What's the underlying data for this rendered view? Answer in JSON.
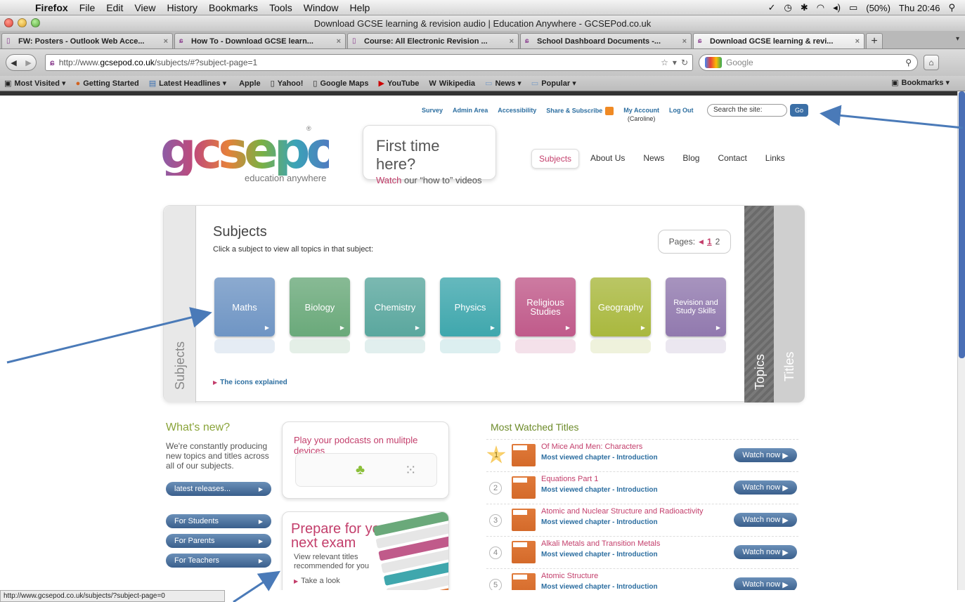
{
  "menubar": {
    "app": "Firefox",
    "items": [
      "File",
      "Edit",
      "View",
      "History",
      "Bookmarks",
      "Tools",
      "Window",
      "Help"
    ],
    "battery": "(50%)",
    "clock": "Thu 20:46"
  },
  "window": {
    "title": "Download GCSE learning & revision audio | Education Anywhere - GCSEPod.co.uk"
  },
  "tabs": [
    {
      "label": "FW: Posters - Outlook Web Acce..."
    },
    {
      "label": "How To - Download GCSE learn..."
    },
    {
      "label": "Course: All Electronic Revision ..."
    },
    {
      "label": "School Dashboard Documents -..."
    },
    {
      "label": "Download GCSE learning & revi..."
    }
  ],
  "url": {
    "prefix": "http://www.",
    "host": "gcsepod.co.uk",
    "path": "/subjects/#?subject-page=1"
  },
  "search": {
    "placeholder": "Google"
  },
  "bookmarks": [
    "Most Visited ▾",
    "Getting Started",
    "Latest Headlines ▾",
    "Apple",
    "Yahoo!",
    "Google Maps",
    "YouTube",
    "Wikipedia",
    "News ▾",
    "Popular ▾"
  ],
  "bookmarks_menu": "Bookmarks",
  "site": {
    "toplinks": [
      "Survey",
      "Admin Area",
      "Accessibility",
      "Share & Subscribe"
    ],
    "my_account": "My Account",
    "account_user": "(Caroline)",
    "logout": "Log Out",
    "site_search_placeholder": "Search the site:",
    "go": "Go",
    "logo_text": "gcsepod",
    "logo_tag": "education anywhere",
    "logo_reg": "®",
    "first_time": "First time here?",
    "watch_word": "Watch",
    "watch_rest": " our “how to” videos",
    "nav": [
      "Subjects",
      "About Us",
      "News",
      "Blog",
      "Contact",
      "Links"
    ]
  },
  "panel": {
    "side_label": "Subjects",
    "title": "Subjects",
    "subtitle": "Click a subject to view all topics in that subject:",
    "pages_label": "Pages:",
    "page_current": "1",
    "page_other": "2",
    "topics_tab": "Topics",
    "titles_tab": "Titles",
    "icons_explained": "The icons explained",
    "subjects": [
      {
        "label": "Maths",
        "color": "#6f95c4"
      },
      {
        "label": "Biology",
        "color": "#6aa97a"
      },
      {
        "label": "Chemistry",
        "color": "#5aa79e"
      },
      {
        "label": "Physics",
        "color": "#3fa7ad"
      },
      {
        "label": "Religious Studies",
        "color": "#c05a8a"
      },
      {
        "label": "Geography",
        "color": "#a9b83e"
      },
      {
        "label": "Revision and Study Skills",
        "color": "#9179ae"
      }
    ]
  },
  "whats_new": {
    "title": "What's new?",
    "desc": "We're constantly producing new topics and titles across all of our subjects.",
    "latest": "latest releases...",
    "for_students": "For Students",
    "for_parents": "For Parents",
    "for_teachers": "For Teachers"
  },
  "podcasts": {
    "title": "Play your podcasts on mulitple devices"
  },
  "prepare": {
    "title": "Prepare for your next exam",
    "sub1": "View relevant titles",
    "sub2": "recommended for you",
    "link": "Take a look"
  },
  "most_watched": {
    "title": "Most Watched Titles",
    "chapter_label": "Most viewed chapter - Introduction",
    "watch": "Watch now",
    "items": [
      {
        "rank": "1",
        "name": "Of Mice And Men: Characters"
      },
      {
        "rank": "2",
        "name": "Equations Part 1"
      },
      {
        "rank": "3",
        "name": "Atomic and Nuclear Structure and Radioactivity"
      },
      {
        "rank": "4",
        "name": "Alkali Metals and Transition Metals"
      },
      {
        "rank": "5",
        "name": "Atomic Structure"
      }
    ]
  },
  "status": "http://www.gcsepod.co.uk/subjects/?subject-page=0",
  "colors": {
    "accent_pink": "#c33e6b",
    "link_blue": "#2c6ea0",
    "annot_arrow": "#4a7ab8"
  }
}
